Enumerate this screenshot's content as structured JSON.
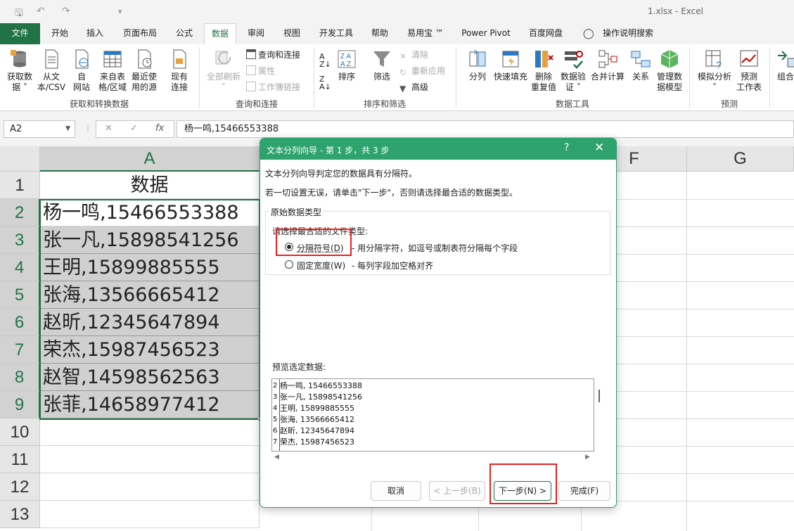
{
  "window": {
    "title": "1.xlsx  -  Excel"
  },
  "tabs": [
    "文件",
    "开始",
    "插入",
    "页面布局",
    "公式",
    "数据",
    "审阅",
    "视图",
    "开发工具",
    "帮助",
    "易用宝 ™",
    "Power Pivot",
    "百度网盘",
    "操作说明搜索"
  ],
  "active_tab": "数据",
  "ribbon": {
    "get": [
      "获取数据",
      "从文本/CSV",
      "自网站",
      "来自表格/区域",
      "最近使用的源",
      "现有连接"
    ],
    "get_l1": [
      "获取数",
      "从文",
      "自",
      "来自表",
      "最近使",
      "现有"
    ],
    "get_l2": [
      "据 ˅",
      "本/CSV",
      "网站",
      "格/区域",
      "用的源",
      "连接"
    ],
    "group_get": "获取和转换数据",
    "refresh_all": "全部刷新",
    "queries": [
      "查询和连接",
      "属性",
      "工作簿链接"
    ],
    "group_queries": "查询和连接",
    "sort": "排序",
    "filter": "筛选",
    "filter_small": [
      "清除",
      "重新应用",
      "高级"
    ],
    "group_sort": "排序和筛选",
    "tools_l1": [
      "分列",
      "快速填充",
      "删除",
      "数据验",
      "合并计算",
      "关系",
      "管理数"
    ],
    "tools_l2": [
      "",
      "",
      "重复值",
      "证 ˅",
      "",
      "",
      "据模型"
    ],
    "group_tools": "数据工具",
    "forecast_l1": [
      "模拟分析",
      "预测"
    ],
    "forecast_l2": [
      "˅",
      "工作表"
    ],
    "group_forecast": "预测",
    "outline": "组合"
  },
  "formula_bar": {
    "name_box": "A2",
    "formula": "杨一鸣,15466553388"
  },
  "sheet": {
    "columns": [
      "A",
      "F",
      "G"
    ],
    "rows": [
      "1",
      "2",
      "3",
      "4",
      "5",
      "6",
      "7",
      "8",
      "9",
      "10",
      "11",
      "12",
      "13"
    ],
    "cells": [
      "数据",
      "杨一鸣,15466553388",
      "张一凡,15898541256",
      "王明,15899885555",
      "张海,13566665412",
      "赵昕,12345647894",
      "荣杰,15987456523",
      "赵智,14598562563",
      "张菲,14658977412"
    ]
  },
  "dialog": {
    "title": "文本分列向导 - 第 1 步，共 3 步",
    "help": "?",
    "close": "✕",
    "line1": "文本分列向导判定您的数据具有分隔符。",
    "line2": "若一切设置无误，请单击\"下一步\"，否则请选择最合适的数据类型。",
    "group_label": "原始数据类型",
    "choose_label": "请选择最合适的文件类型:",
    "opt_delimited": "分隔符号(D)",
    "opt_delimited_desc": "- 用分隔字符，如逗号或制表符分隔每个字段",
    "opt_fixed": "固定宽度(W)",
    "opt_fixed_desc": "- 每列字段加空格对齐",
    "preview_label": "预览选定数据:",
    "preview_nums": [
      "2",
      "3",
      "4",
      "5",
      "6",
      "7"
    ],
    "preview_lines": [
      "杨一鸣, 15466553388",
      "张一凡, 15898541256",
      "王明, 15899885555",
      "张海, 13566665412",
      "赵昕, 12345647894",
      "荣杰, 15987456523"
    ],
    "btn_cancel": "取消",
    "btn_back": "< 上一步(B)",
    "btn_next": "下一步(N) >",
    "btn_finish": "完成(F)"
  },
  "colors": {
    "excel_green": "#217346",
    "dialog_title": "#2ea36d",
    "highlight_red": "#e82020"
  }
}
